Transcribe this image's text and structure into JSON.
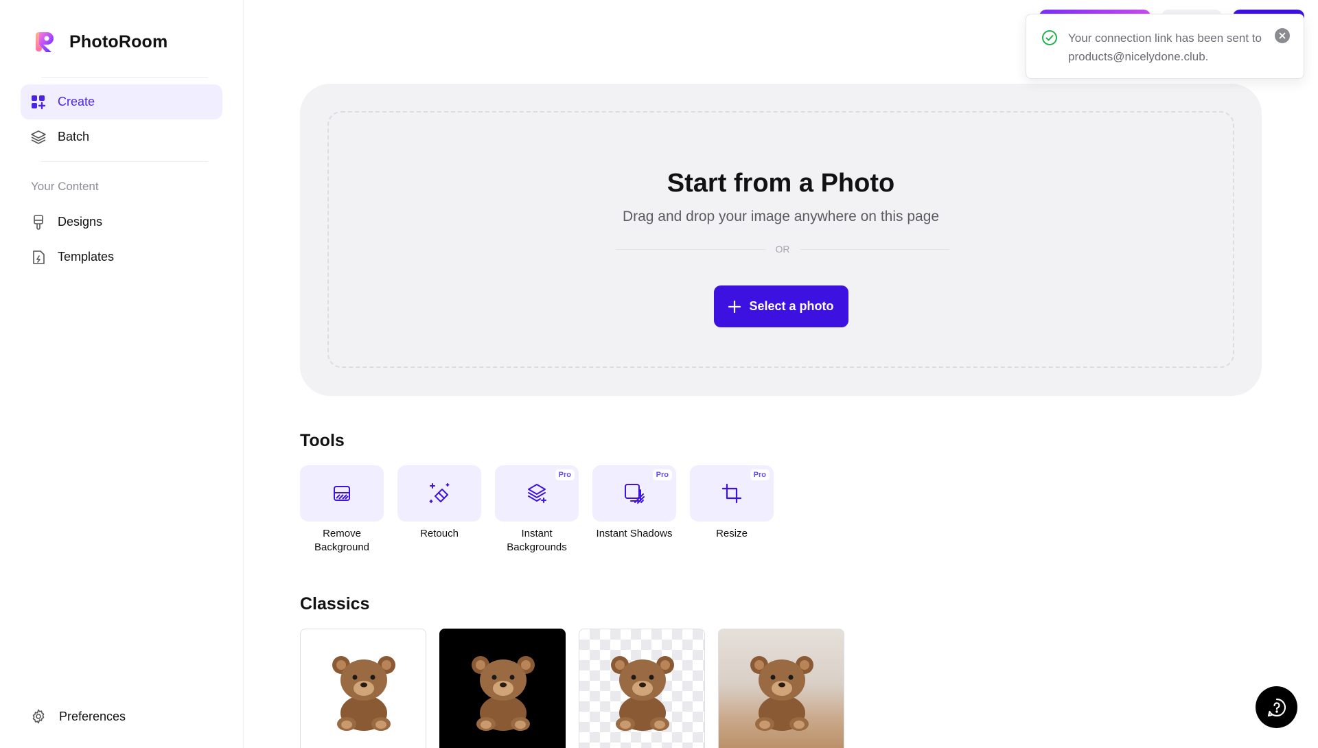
{
  "app": {
    "name": "PhotoRoom"
  },
  "sidebar": {
    "nav": [
      {
        "label": "Create",
        "icon": "grid-plus-icon",
        "active": true
      },
      {
        "label": "Batch",
        "icon": "layers-icon",
        "active": false
      }
    ],
    "content_section_label": "Your Content",
    "content_items": [
      {
        "label": "Designs",
        "icon": "paintbrush-icon"
      },
      {
        "label": "Templates",
        "icon": "template-file-icon"
      }
    ],
    "preferences_label": "Preferences"
  },
  "upload": {
    "title": "Start from a Photo",
    "subtitle": "Drag and drop your image anywhere on this page",
    "or_label": "OR",
    "button_label": "Select a photo"
  },
  "tools": {
    "title": "Tools",
    "items": [
      {
        "label": "Remove Background",
        "icon": "remove-background-icon",
        "badge": ""
      },
      {
        "label": "Retouch",
        "icon": "eraser-sparkle-icon",
        "badge": ""
      },
      {
        "label": "Instant Backgrounds",
        "icon": "layers-sparkle-icon",
        "badge": "Pro"
      },
      {
        "label": "Instant Shadows",
        "icon": "shadow-square-icon",
        "badge": "Pro"
      },
      {
        "label": "Resize",
        "icon": "crop-icon",
        "badge": "Pro"
      }
    ]
  },
  "classics": {
    "title": "Classics",
    "items": [
      {
        "variant": "white-background",
        "image": "teddy-bear"
      },
      {
        "variant": "black-background",
        "image": "teddy-bear"
      },
      {
        "variant": "transparent-background",
        "image": "teddy-bear"
      },
      {
        "variant": "room-scene-background",
        "image": "teddy-bear"
      }
    ]
  },
  "toast": {
    "message": "Your connection link has been sent to products@nicelydone.club.",
    "status": "success"
  },
  "colors": {
    "accent": "#3d12e1",
    "accent_light": "#f1efff",
    "success": "#22b04b",
    "card_bg": "#f2f2f4"
  }
}
